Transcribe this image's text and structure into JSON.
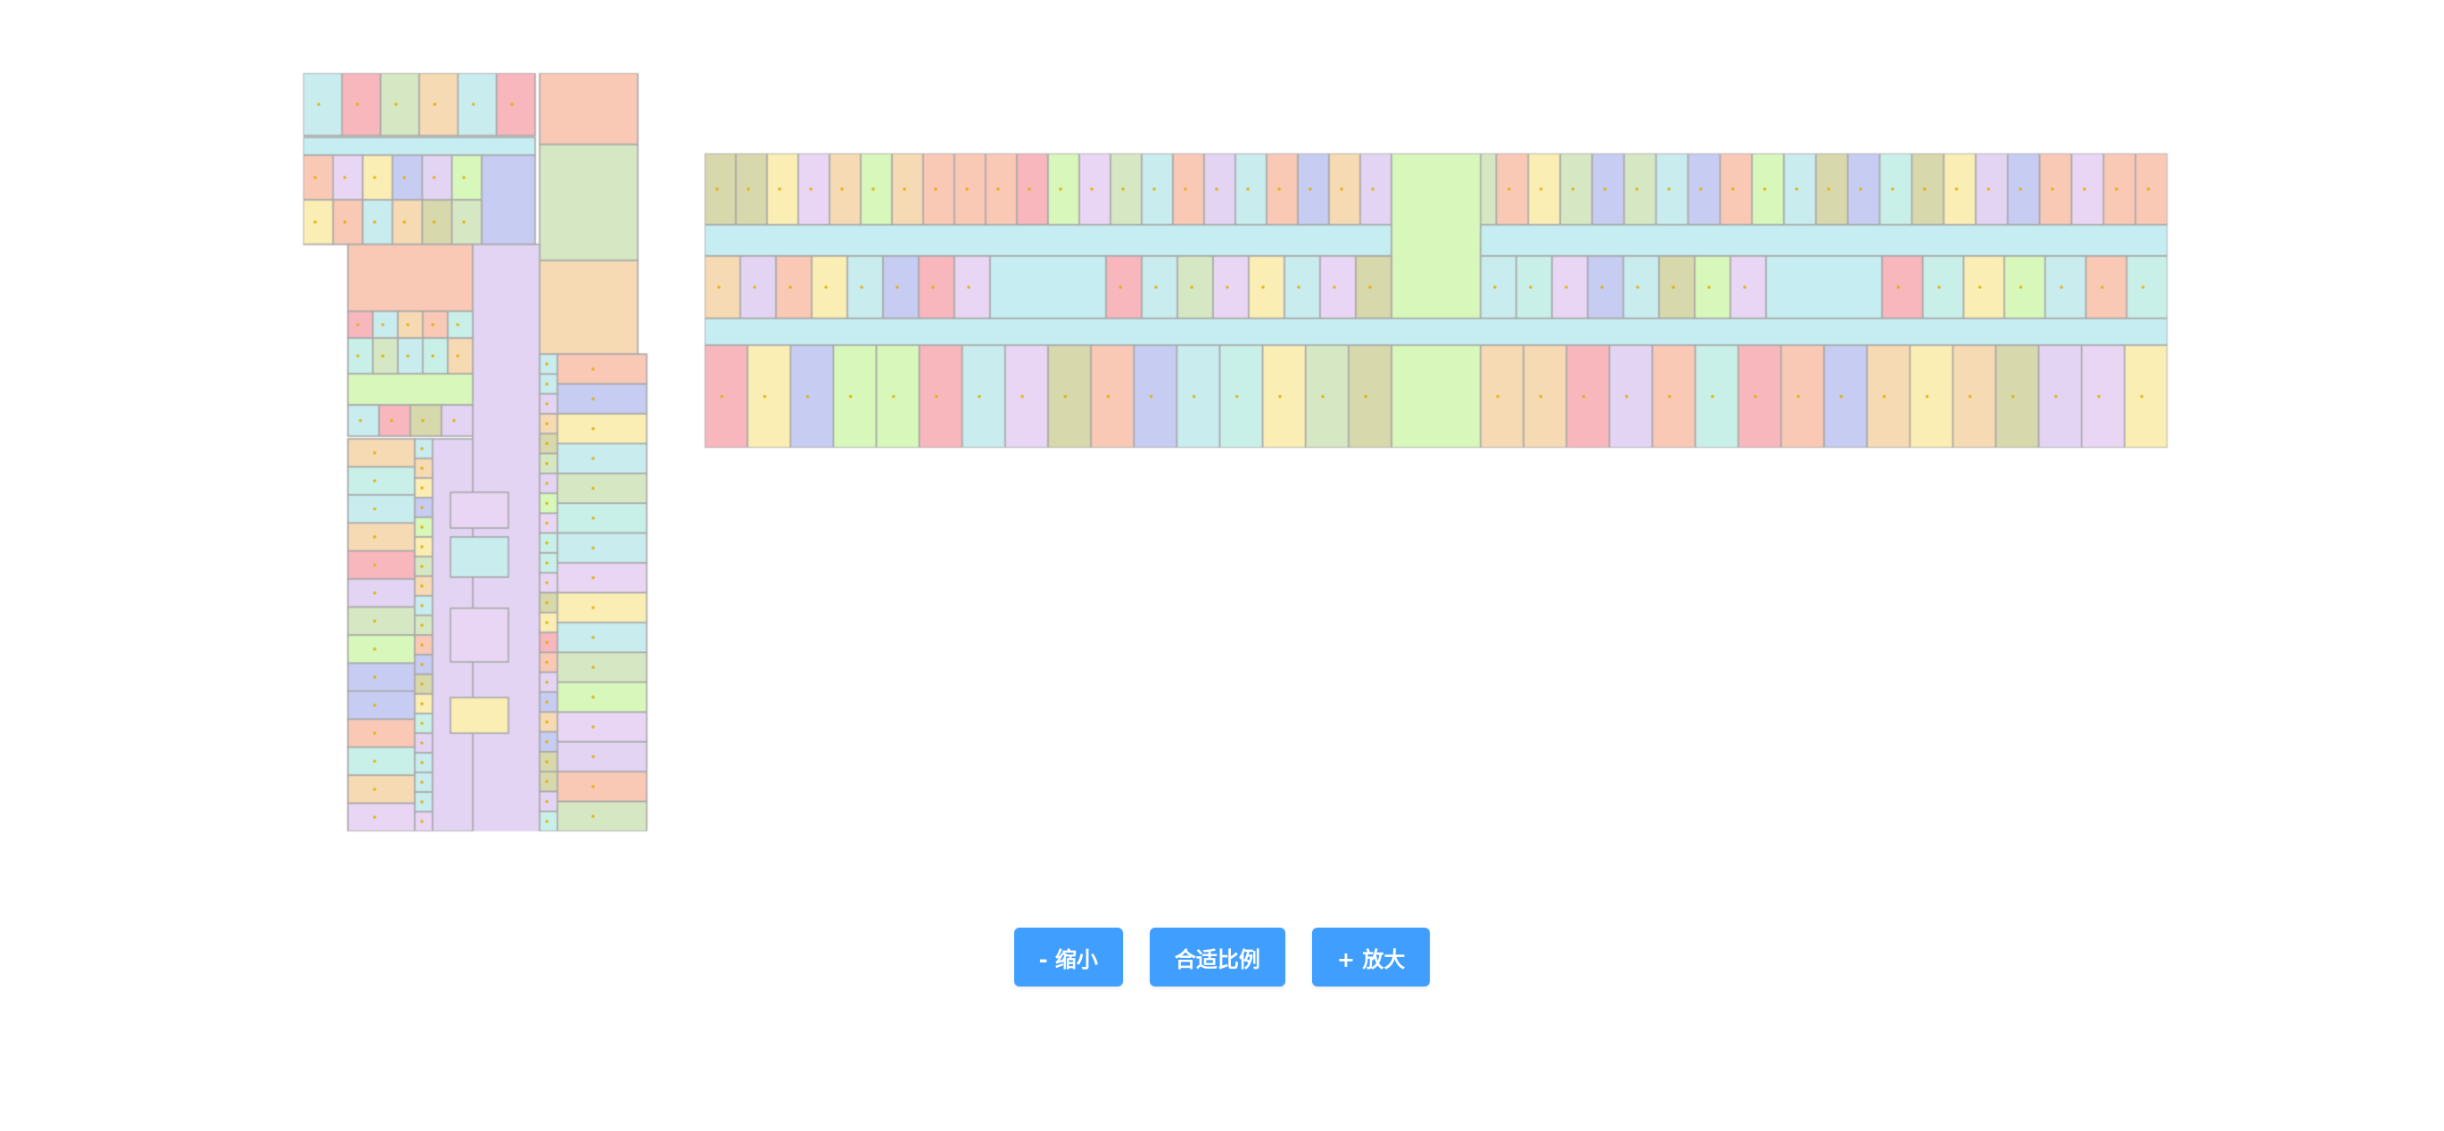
{
  "controls": {
    "zoom_out_label": "- 缩小",
    "fit_label": "合适比例",
    "zoom_in_label": "+ 放大"
  },
  "colors": {
    "button_bg": "#409eff",
    "button_text": "#ffffff",
    "wall": "#a6a6a6",
    "corridor": "#c6eef2",
    "palette": [
      "#f9c9b6",
      "#d6e8c3",
      "#f6dab3",
      "#e3d4f4",
      "#c7ccf2",
      "#c9ecef",
      "#f7b7bd",
      "#faeeb4",
      "#d7d8ac",
      "#d7f7bb",
      "#e9d6f4",
      "#c9f0e8"
    ]
  },
  "floor_plans": [
    {
      "id": "wing-vertical"
    },
    {
      "id": "wing-horizontal"
    }
  ]
}
